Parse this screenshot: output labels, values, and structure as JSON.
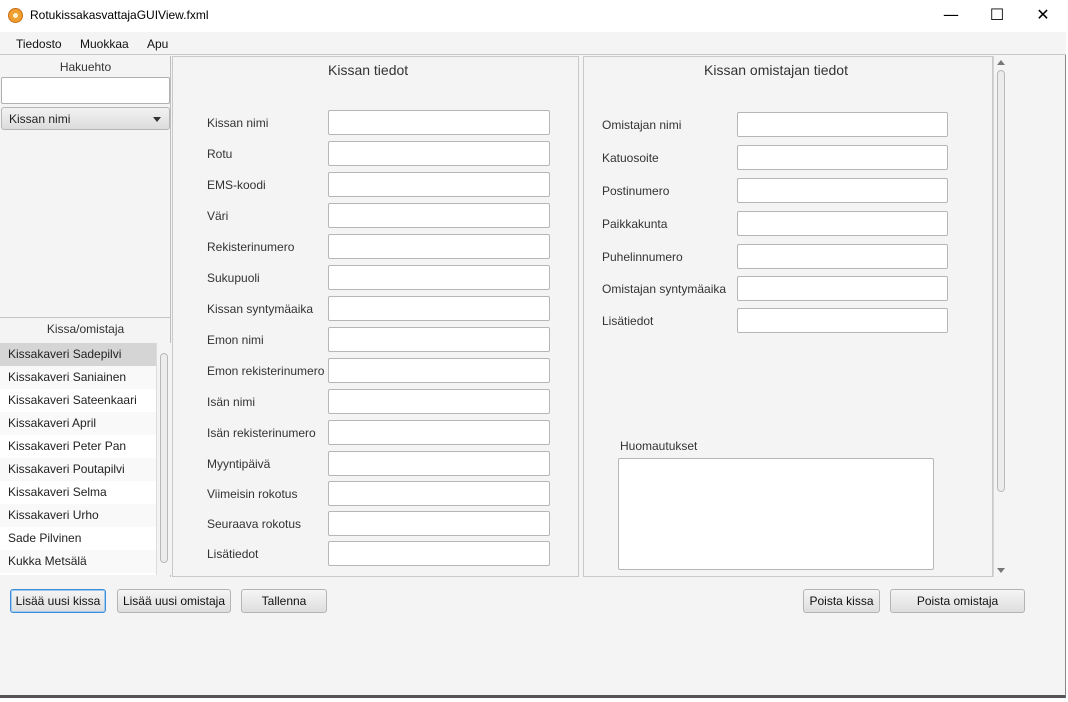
{
  "window": {
    "title": "RotukissakasvattajaGUIView.fxml",
    "minimize_glyph": "—",
    "maximize_glyph": "☐",
    "close_glyph": "✕"
  },
  "menu": [
    "Tiedosto",
    "Muokkaa",
    "Apu"
  ],
  "left": {
    "search_header": "Hakuehto",
    "search_value": "",
    "combo_selected": "Kissan nimi",
    "list_header": "Kissa/omistaja",
    "items": [
      "Kissakaveri Sadepilvi",
      "Kissakaveri Saniainen",
      "Kissakaveri Sateenkaari",
      "Kissakaveri April",
      "Kissakaveri Peter Pan",
      "Kissakaveri Poutapilvi",
      "Kissakaveri Selma",
      "Kissakaveri Urho",
      "Sade Pilvinen",
      "Kukka Metsälä"
    ]
  },
  "cat": {
    "title": "Kissan tiedot",
    "fields": [
      "Kissan nimi",
      "Rotu",
      "EMS-koodi",
      "Väri",
      "Rekisterinumero",
      "Sukupuoli",
      "Kissan syntymäaika",
      "Emon nimi",
      "Emon rekisterinumero",
      "Isän nimi",
      "Isän rekisterinumero",
      "Myyntipäivä",
      "Viimeisin rokotus",
      "Seuraava rokotus",
      "Lisätiedot"
    ]
  },
  "owner": {
    "title": "Kissan omistajan tiedot",
    "fields": [
      "Omistajan nimi",
      "Katuosoite",
      "Postinumero",
      "Paikkakunta",
      "Puhelinnumero",
      "Omistajan syntymäaika",
      "Lisätiedot"
    ],
    "notes_label": "Huomautukset",
    "notes_value": ""
  },
  "buttons": {
    "add_cat": "Lisää uusi kissa",
    "add_owner": "Lisää uusi omistaja",
    "save": "Tallenna",
    "delete_cat": "Poista kissa",
    "delete_owner": "Poista omistaja"
  },
  "colors": {
    "focus": "#3d8ed9",
    "selected_row": "#d5d5d5",
    "window_bg": "#f4f4f4"
  }
}
